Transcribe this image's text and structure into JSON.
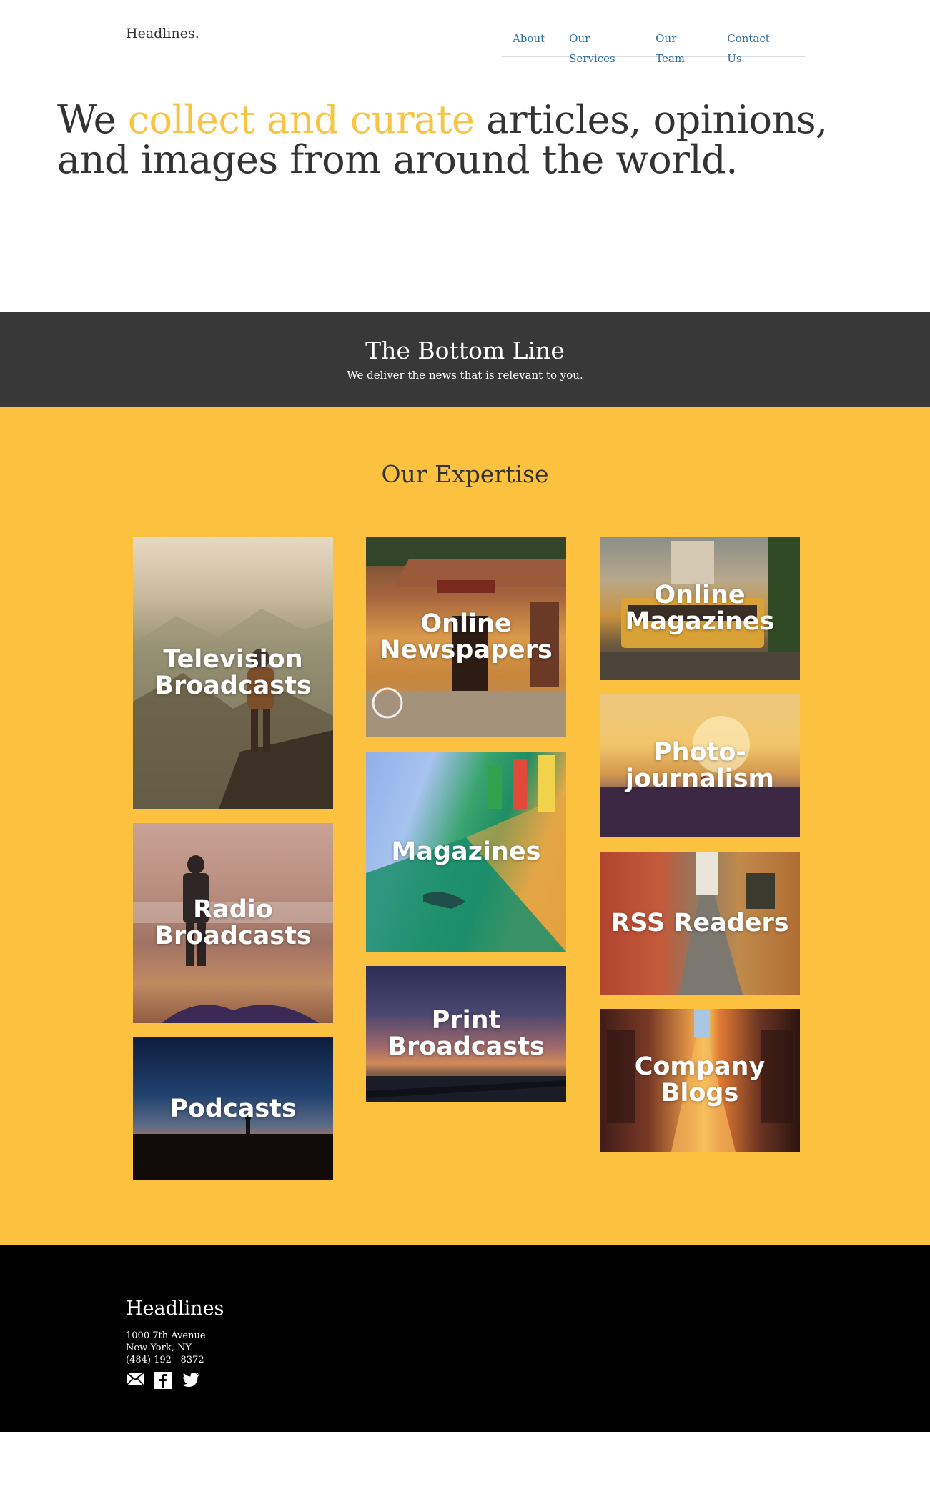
{
  "header": {
    "logo": "Headlines.",
    "nav": [
      "About",
      "Our Services",
      "Our Team",
      "Contact Us"
    ]
  },
  "hero": {
    "text_before": "We ",
    "text_accent": "collect and curate",
    "text_after": " articles, opinions, and images from around the world."
  },
  "bottom_line": {
    "title": "The Bottom Line",
    "subtitle": "We deliver the news that is relevant to you."
  },
  "expertise": {
    "title": "Our Expertise",
    "tiles": {
      "television": "Television Broadcasts",
      "radio": "Radio Broadcasts",
      "podcasts": "Podcasts",
      "online_newspapers": "Online Newspapers",
      "magazines": "Magazines",
      "print": "Print Broadcasts",
      "online_magazines": "Online Magazines",
      "photojournalism": "Photo-\njournalism",
      "rss": "RSS Readers",
      "blogs": "Company Blogs"
    }
  },
  "footer": {
    "title": "Headlines",
    "address_line1": "1000 7th Avenue",
    "address_line2": "New York, NY",
    "phone": "(484) 192 - 8372",
    "social_icons": [
      "mail-icon",
      "facebook-icon",
      "twitter-icon"
    ]
  },
  "colors": {
    "accent": "#f7c443",
    "expertise_bg": "#fcc13f",
    "band_bg": "#383838",
    "footer_bg": "#000000",
    "nav_link": "#2f6f9f"
  }
}
